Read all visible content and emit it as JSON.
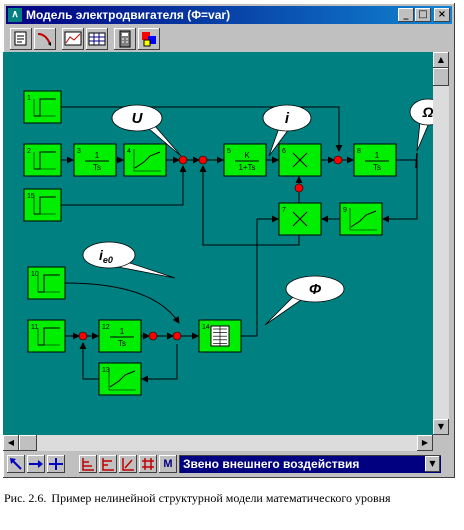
{
  "window": {
    "title": "Модель электродвигателя (Φ=var)",
    "icon": "model-app-icon",
    "buttons": [
      "minimize-icon",
      "maximize-icon",
      "close-icon"
    ]
  },
  "toolbar": {
    "tools": [
      "open-model-icon",
      "connect-link-icon",
      "graph-icon",
      "table-icon",
      "calculator-icon",
      "properties-icon"
    ]
  },
  "canvas": {
    "background": "#008080",
    "block_fill": "#00ee00",
    "summator_fill": "#ff0000",
    "blocks": [
      {
        "n": "1",
        "kind": "step"
      },
      {
        "n": "2",
        "kind": "step"
      },
      {
        "n": "3",
        "kind": "tf",
        "num": "1",
        "den": "Ts"
      },
      {
        "n": "4",
        "kind": "nonlinear"
      },
      {
        "n": "5",
        "kind": "tf",
        "num": "K",
        "den": "1+Ts"
      },
      {
        "n": "6",
        "kind": "multiply"
      },
      {
        "n": "8",
        "kind": "tf",
        "num": "1",
        "den": "Ts"
      },
      {
        "n": "15",
        "kind": "step"
      },
      {
        "n": "7",
        "kind": "multiply"
      },
      {
        "n": "9",
        "kind": "nonlinear"
      },
      {
        "n": "10",
        "kind": "step"
      },
      {
        "n": "11",
        "kind": "step"
      },
      {
        "n": "12",
        "kind": "tf",
        "num": "1",
        "den": "Ts"
      },
      {
        "n": "14",
        "kind": "table"
      },
      {
        "n": "13",
        "kind": "nonlinear"
      }
    ],
    "callouts": {
      "u": "U",
      "i": "i",
      "omega": "Ω",
      "ie0_base": "i",
      "ie0_sub": "e0",
      "phi": "Φ"
    }
  },
  "bottombar": {
    "tools": [
      "select-arrow-icon",
      "link-arrow-icon",
      "node-icon",
      "align-left-icon",
      "align-center-icon",
      "align-right-icon",
      "grid-icon"
    ],
    "m_label": "M",
    "select_value": "Звено внешнего воздействия"
  },
  "caption": {
    "label": "Рис. 2.6.",
    "text": "Пример нелинейной структурной модели математического уровня"
  }
}
